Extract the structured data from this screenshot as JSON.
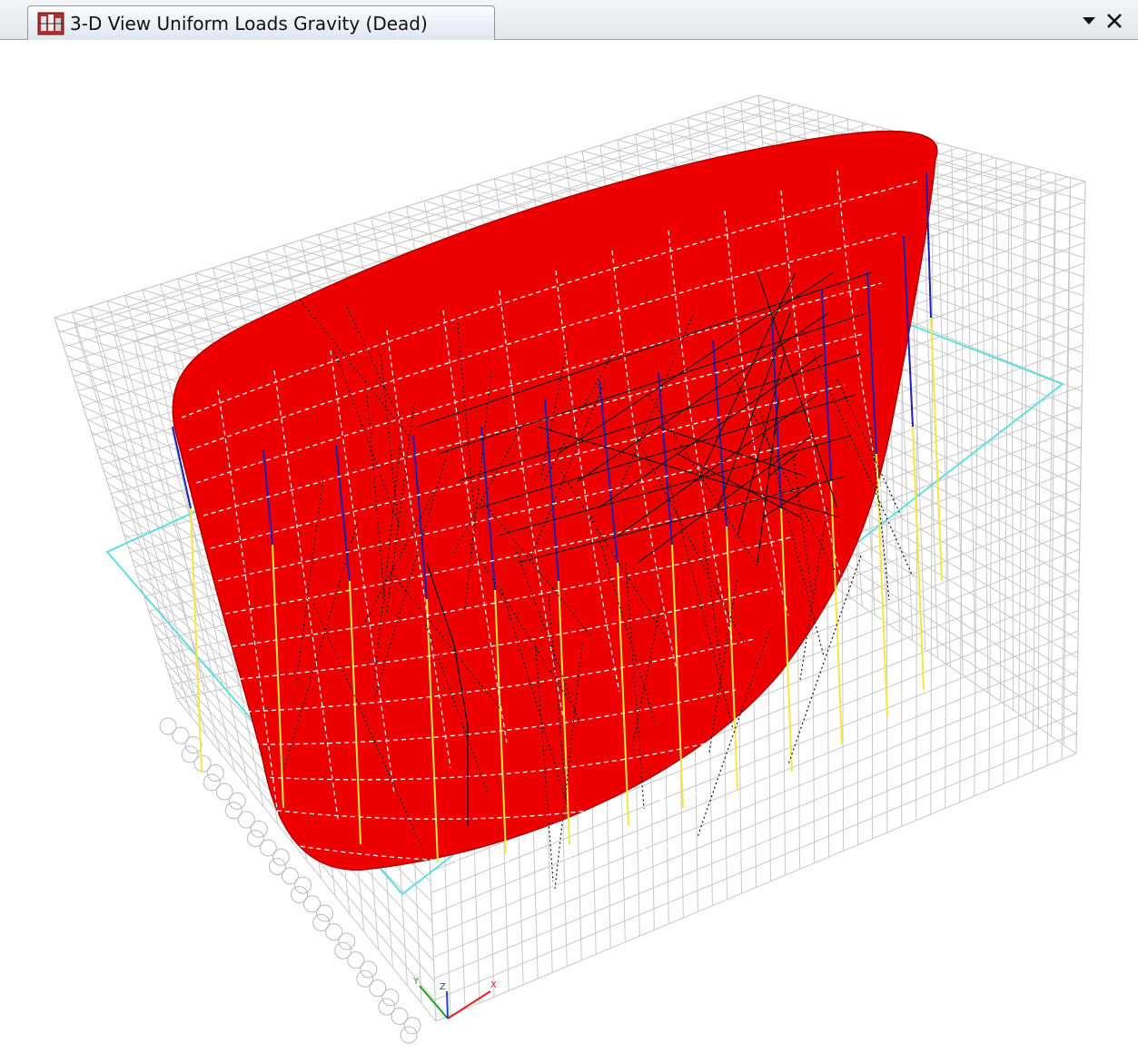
{
  "window": {
    "tab_title": "3-D View  Uniform Loads Gravity  (Dead)",
    "tab_icon": "model-view-icon",
    "dropdown_icon": "chevron-down-icon",
    "close_icon": "close-icon"
  },
  "axes": {
    "x_label": "X",
    "y_label": "Y",
    "z_label": "Z"
  },
  "colors": {
    "load_surface": "#ee0000",
    "mesh_lines": "#c8c8c8",
    "plane_outline": "#62dede",
    "column_blue": "#2020b0",
    "column_yellow": "#f6e642",
    "x_axis": "#e02020",
    "y_axis": "#20a020",
    "z_axis": "#2040e0"
  }
}
